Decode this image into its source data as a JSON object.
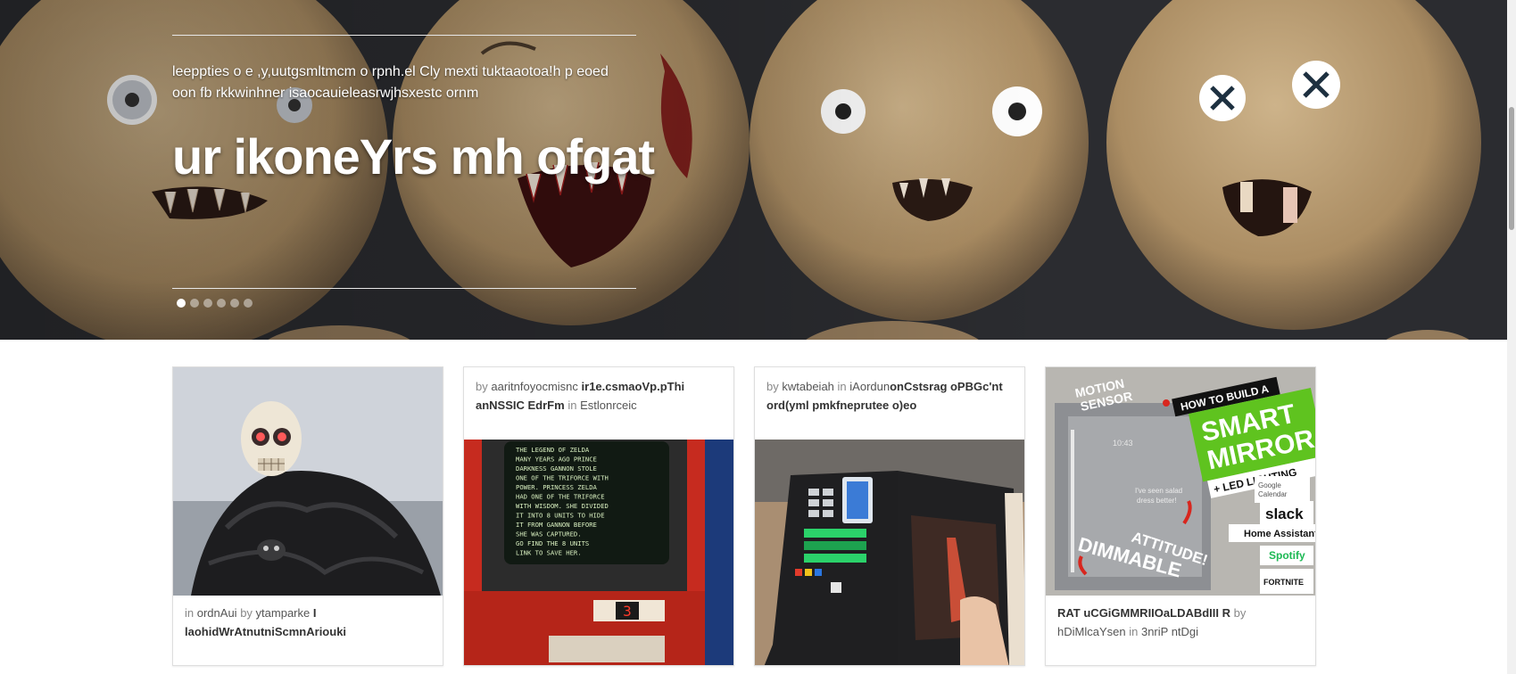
{
  "hero": {
    "kicker": "leeppties o e ,y,uutgsmltmcm o rpnh.el Cly mexti tuktaaotoa!h p eoed oon fb rkkwinhner isaocauieleasrwjhsxestc ornm",
    "title": "ur ikoneYrs mh ofgat",
    "slide_count": 6,
    "active_slide": 1
  },
  "cards": [
    {
      "image": "skeleton-figure",
      "in_label": "in",
      "category": "ordnAui",
      "by_label": "by",
      "author": "ytamparke",
      "title": "I laohidWrAtnutniScmnAriouki"
    },
    {
      "image": "zelda-arcade",
      "by_label": "by",
      "author": "aaritnfoyocmisnc",
      "title": "ir1e.csmaoVp.pThi anNSSIC EdrFm",
      "in_label": "in",
      "category": "Estlonrceic",
      "screen_lines": [
        "THE LEGEND OF ZELDA",
        "MANY YEARS AGO PRINCE",
        "DARKNESS  GANNON  STOLE",
        "ONE OF THE TRIFORCE WITH",
        "POWER.    PRINCESS ZELDA",
        "HAD  ONE OF THE TRIFORCE",
        "WITH WISDOM. SHE DIVIDED",
        "IT INTO  8 UNITS TO HIDE",
        "IT FROM   GANNON  BEFORE",
        "SHE WAS CAPTURED.",
        "GO FIND THE  8 UNITS",
        "LINK   TO SAVE HER."
      ],
      "counter": "3"
    },
    {
      "image": "book-console",
      "by_label": "by",
      "author": "kwtabeiah",
      "in_label": "in",
      "category": "iAordun",
      "title": "onCstsrag oPBGc'nt ord(yml pmkfneprutee o)eo"
    },
    {
      "image": "smart-mirror",
      "title": "RAT uCGiGMMRIIOaLDABdIII R",
      "by_label": "by",
      "author": "hDiMlcaYsen",
      "in_label": "in",
      "category": "3nriP ntDgi",
      "mirror": {
        "motion": "MOTION",
        "sensor": "SENSOR",
        "howto": "HOW TO BUILD A",
        "smart": "SMART",
        "mirror": "MIRROR",
        "led": "+ LED LIGHTING",
        "attitude": "ATTITUDE!",
        "dimmable": "DIMMABLE",
        "google1": "Google",
        "google2": "Calendar",
        "slack": "slack",
        "home": "Home Assistant",
        "spotify": "Spotify",
        "fortnite": "FORTNITE",
        "clock": "10:43",
        "quote1": "I've seen salad",
        "quote2": "dress better!"
      }
    }
  ],
  "colors": {
    "hero_text": "#ffffff",
    "card_title": "#333333",
    "card_meta": "#888888",
    "mirror_green": "#5fc31f",
    "arrow_red": "#d8261e"
  }
}
